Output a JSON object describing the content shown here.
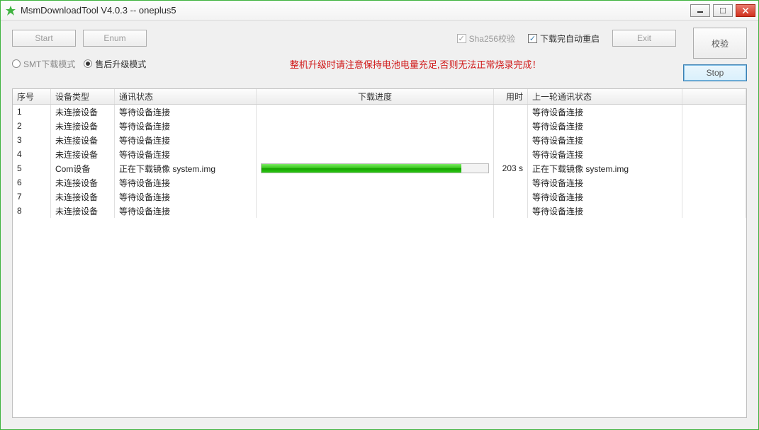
{
  "title": "MsmDownloadTool V4.0.3 -- oneplus5",
  "buttons": {
    "start": "Start",
    "enum": "Enum",
    "exit": "Exit",
    "stop": "Stop",
    "verify": "校验"
  },
  "checks": {
    "sha256": "Sha256校验",
    "autoreboot": "下载完自动重启"
  },
  "radios": {
    "smt": "SMT下载模式",
    "aftersale": "售后升级模式"
  },
  "warning": "整机升级时请注意保持电池电量充足,否则无法正常烧录完成！",
  "columns": {
    "idx": "序号",
    "devtype": "设备类型",
    "commstate": "通讯状态",
    "progress": "下载进度",
    "elapsed": "用时",
    "lastcomm": "上一轮通讯状态"
  },
  "rows": [
    {
      "idx": "1",
      "dev": "未连接设备",
      "comm": "等待设备连接",
      "progress": null,
      "elapsed": "",
      "last": "等待设备连接"
    },
    {
      "idx": "2",
      "dev": "未连接设备",
      "comm": "等待设备连接",
      "progress": null,
      "elapsed": "",
      "last": "等待设备连接"
    },
    {
      "idx": "3",
      "dev": "未连接设备",
      "comm": "等待设备连接",
      "progress": null,
      "elapsed": "",
      "last": "等待设备连接"
    },
    {
      "idx": "4",
      "dev": "未连接设备",
      "comm": "等待设备连接",
      "progress": null,
      "elapsed": "",
      "last": "等待设备连接"
    },
    {
      "idx": "5",
      "dev": "Com设备",
      "comm": "正在下载镜像 system.img",
      "progress": 88,
      "elapsed": "203 s",
      "last": "正在下载镜像 system.img"
    },
    {
      "idx": "6",
      "dev": "未连接设备",
      "comm": "等待设备连接",
      "progress": null,
      "elapsed": "",
      "last": "等待设备连接"
    },
    {
      "idx": "7",
      "dev": "未连接设备",
      "comm": "等待设备连接",
      "progress": null,
      "elapsed": "",
      "last": "等待设备连接"
    },
    {
      "idx": "8",
      "dev": "未连接设备",
      "comm": "等待设备连接",
      "progress": null,
      "elapsed": "",
      "last": "等待设备连接"
    }
  ]
}
